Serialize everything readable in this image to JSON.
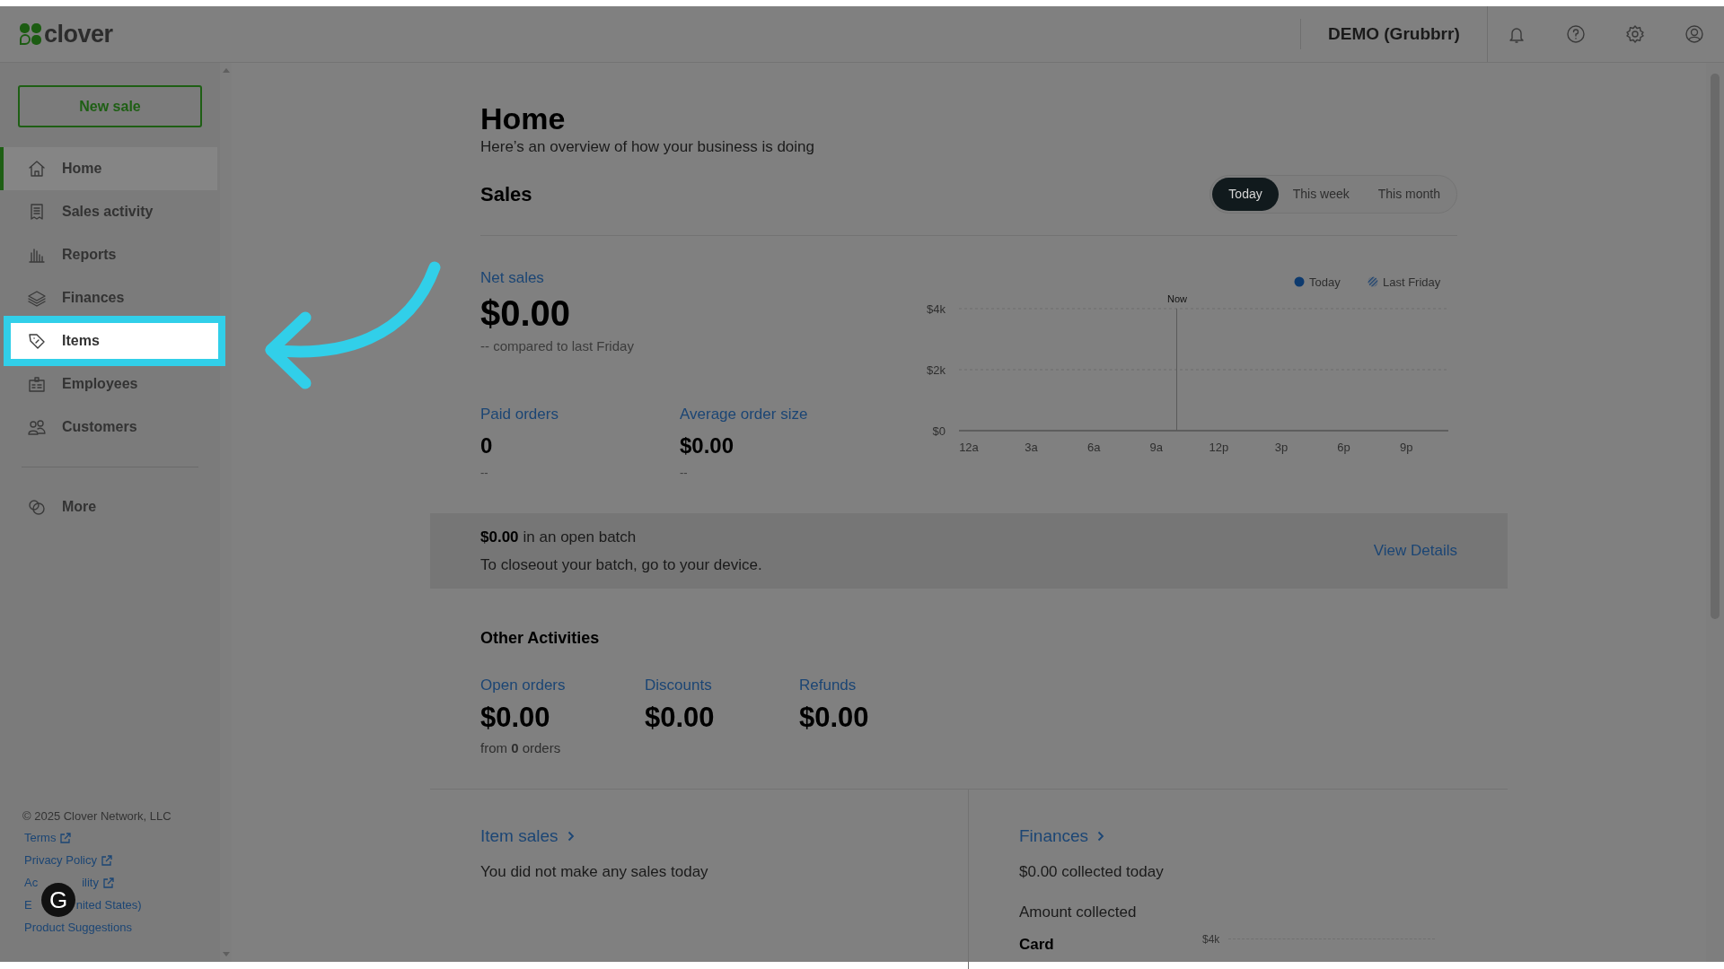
{
  "header": {
    "logo": "clover",
    "merchant": "DEMO (Grubbrr)"
  },
  "sidebar": {
    "new_sale": "New sale",
    "items": [
      {
        "label": "Home",
        "selected": true,
        "highlighted": false
      },
      {
        "label": "Sales activity",
        "selected": false,
        "highlighted": false
      },
      {
        "label": "Reports",
        "selected": false,
        "highlighted": false
      },
      {
        "label": "Finances",
        "selected": false,
        "highlighted": false
      },
      {
        "label": "Items",
        "selected": false,
        "highlighted": true
      },
      {
        "label": "Employees",
        "selected": false,
        "highlighted": false
      },
      {
        "label": "Customers",
        "selected": false,
        "highlighted": false
      }
    ],
    "more": {
      "label": "More"
    },
    "copyright": "© 2025 Clover Network, LLC",
    "links": [
      {
        "segments": [
          "Terms"
        ],
        "external": true
      },
      {
        "segments": [
          "Privacy Policy"
        ],
        "external": true
      },
      {
        "segments": [
          "Ac",
          "ility"
        ],
        "external": true
      },
      {
        "segments": [
          "E",
          "nited States)"
        ],
        "external": false
      },
      {
        "segments": [
          "Product Suggestions"
        ],
        "external": false
      }
    ]
  },
  "page": {
    "title": "Home",
    "subtitle": "Here’s an overview of how your business is doing"
  },
  "sales": {
    "title": "Sales",
    "periods": [
      {
        "label": "Today",
        "selected": true
      },
      {
        "label": "This week",
        "selected": false
      },
      {
        "label": "This month",
        "selected": false
      }
    ],
    "net_sales": {
      "label": "Net sales",
      "value": "$0.00",
      "comparison": "-- compared to last Friday"
    },
    "stats": [
      {
        "label": "Paid orders",
        "value": "0",
        "comparison": "--"
      },
      {
        "label": "Average order size",
        "value": "$0.00",
        "comparison": "--"
      }
    ],
    "chart_data": {
      "type": "line",
      "categories": [
        "12a",
        "3a",
        "6a",
        "9a",
        "12p",
        "3p",
        "6p",
        "9p"
      ],
      "ylim": [
        0,
        4000
      ],
      "yticks": [
        {
          "value": 0,
          "label": "$0"
        },
        {
          "value": 2000,
          "label": "$2k"
        },
        {
          "value": 4000,
          "label": "$4k"
        }
      ],
      "series": [
        {
          "name": "Today",
          "color": "#0d3a6e",
          "values": [
            null,
            null,
            null,
            null,
            null,
            null,
            null,
            null
          ]
        },
        {
          "name": "Last Friday",
          "color": "#1f4470",
          "values": [
            null,
            null,
            null,
            null,
            null,
            null,
            null,
            null
          ]
        }
      ]
    },
    "now_marker": {
      "label": "Now"
    }
  },
  "batch": {
    "amount": "$0.00",
    "text": "in an open batch",
    "instruction": "To closeout your batch, go to your device.",
    "link": "View Details"
  },
  "other_activities": {
    "title": "Other Activities",
    "items": [
      {
        "label": "Open orders",
        "value": "$0.00",
        "note": "from **0** orders"
      },
      {
        "label": "Discounts",
        "value": "$0.00"
      },
      {
        "label": "Refunds",
        "value": "$0.00"
      }
    ]
  },
  "item_sales": {
    "title": "Item sales",
    "text": "You did not make any sales today"
  },
  "finances": {
    "title": "Finances",
    "text": "$0.00 collected today",
    "subtitle": "Amount collected",
    "card_label": "Card",
    "axis_label": "$4k"
  },
  "floating_button": {
    "label": "G"
  }
}
